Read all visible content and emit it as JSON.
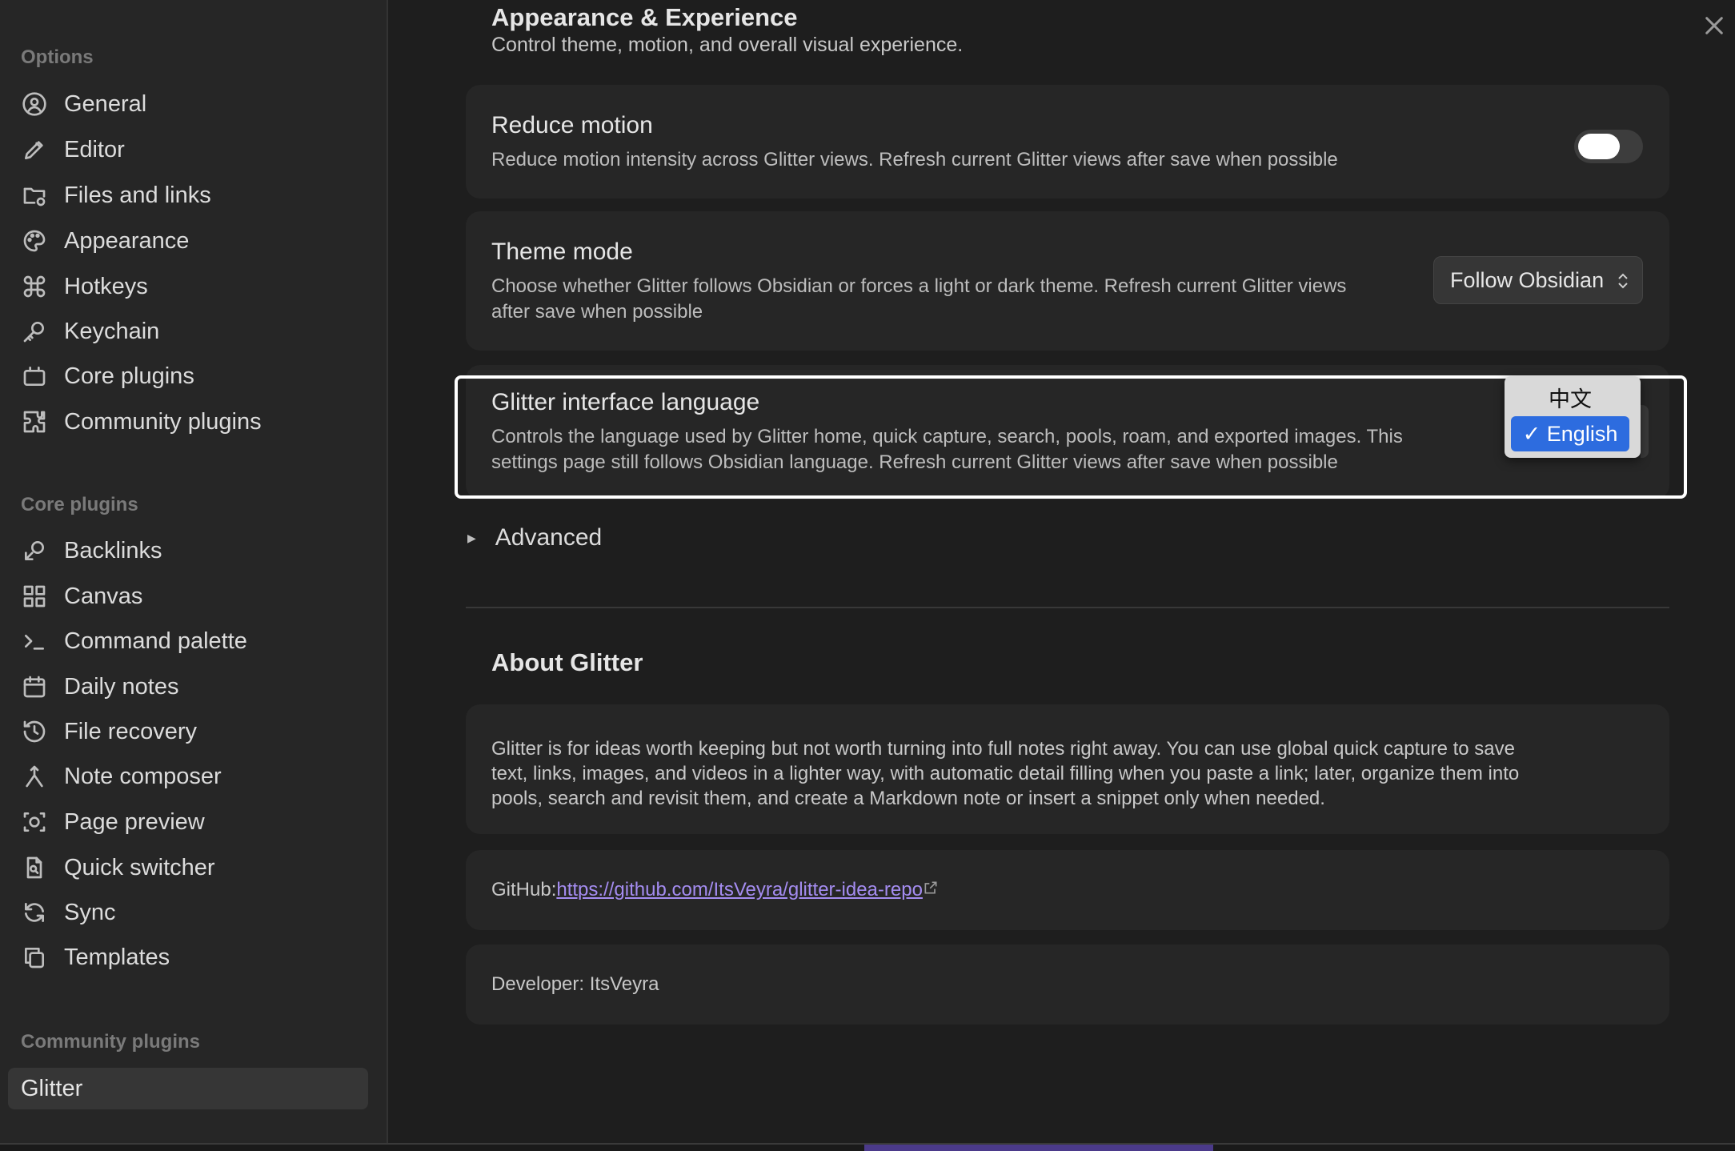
{
  "sidebar": {
    "options_title": "Options",
    "options": [
      {
        "label": "General",
        "icon": "user-circle-icon"
      },
      {
        "label": "Editor",
        "icon": "pencil-icon"
      },
      {
        "label": "Files and links",
        "icon": "folder-gear-icon"
      },
      {
        "label": "Appearance",
        "icon": "palette-icon"
      },
      {
        "label": "Hotkeys",
        "icon": "command-icon"
      },
      {
        "label": "Keychain",
        "icon": "key-icon"
      },
      {
        "label": "Core plugins",
        "icon": "plug-box-icon"
      },
      {
        "label": "Community plugins",
        "icon": "puzzle-icon"
      }
    ],
    "core_title": "Core plugins",
    "core": [
      {
        "label": "Backlinks",
        "icon": "backlinks-icon"
      },
      {
        "label": "Canvas",
        "icon": "canvas-icon"
      },
      {
        "label": "Command palette",
        "icon": "terminal-icon"
      },
      {
        "label": "Daily notes",
        "icon": "calendar-icon"
      },
      {
        "label": "File recovery",
        "icon": "history-icon"
      },
      {
        "label": "Note composer",
        "icon": "merge-icon"
      },
      {
        "label": "Page preview",
        "icon": "preview-icon"
      },
      {
        "label": "Quick switcher",
        "icon": "file-search-icon"
      },
      {
        "label": "Sync",
        "icon": "sync-icon"
      },
      {
        "label": "Templates",
        "icon": "copy-icon"
      }
    ],
    "community_title": "Community plugins",
    "community_active": "Glitter"
  },
  "main": {
    "section_title": "Appearance & Experience",
    "section_subtitle": "Control theme, motion, and overall visual experience.",
    "reduce_motion": {
      "title": "Reduce motion",
      "desc": "Reduce motion intensity across Glitter views. Refresh current Glitter views after save when possible",
      "enabled": false
    },
    "theme_mode": {
      "title": "Theme mode",
      "desc_line1": "Choose whether Glitter follows Obsidian or forces a light or dark theme. Refresh current Glitter views",
      "desc_line2": "after save when possible",
      "value": "Follow Obsidian"
    },
    "language": {
      "title": "Glitter interface language",
      "desc_line1": "Controls the language used by Glitter home, quick capture, search, pools, roam, and exported images. This",
      "desc_line2": "settings page still follows Obsidian language. Refresh current Glitter views after save when possible",
      "options": [
        "中文",
        "✓ English"
      ],
      "selected": "English"
    },
    "advanced_label": "Advanced",
    "about_title": "About Glitter",
    "about_line1": "Glitter is for ideas worth keeping but not worth turning into full notes right away. You can use global quick capture to save",
    "about_line2": "text, links, images, and videos in a lighter way, with automatic detail filling when you paste a link; later, organize them into",
    "about_line3": "pools, search and revisit them, and create a Markdown note or insert a snippet only when needed.",
    "github_label": "GitHub: ",
    "github_url": "https://github.com/ItsVeyra/glitter-idea-repo",
    "developer": "Developer: ItsVeyra"
  },
  "colors": {
    "accent_link": "#a48cf0",
    "selected_option": "#2d6cdf"
  }
}
